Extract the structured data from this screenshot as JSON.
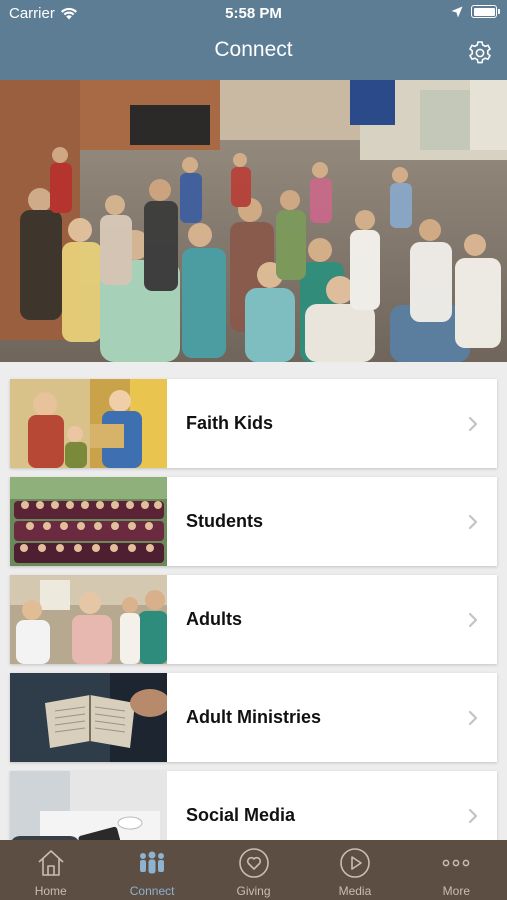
{
  "status_bar": {
    "carrier": "Carrier",
    "time": "5:58 PM"
  },
  "header": {
    "title": "Connect",
    "settings_icon": "gear-icon"
  },
  "colors": {
    "header_bg": "#5d7d94",
    "tabbar_bg": "#5c4e43",
    "active_tab": "#8fb2cf",
    "inactive_tab": "#c9bdb2"
  },
  "list": {
    "items": [
      {
        "label": "Faith Kids"
      },
      {
        "label": "Students"
      },
      {
        "label": "Adults"
      },
      {
        "label": "Adult Ministries"
      },
      {
        "label": "Social Media"
      }
    ]
  },
  "tabs": [
    {
      "label": "Home",
      "icon": "house-icon",
      "active": false
    },
    {
      "label": "Connect",
      "icon": "people-icon",
      "active": true
    },
    {
      "label": "Giving",
      "icon": "heart-icon",
      "active": false
    },
    {
      "label": "Media",
      "icon": "play-icon",
      "active": false
    },
    {
      "label": "More",
      "icon": "more-dots-icon",
      "active": false
    }
  ]
}
